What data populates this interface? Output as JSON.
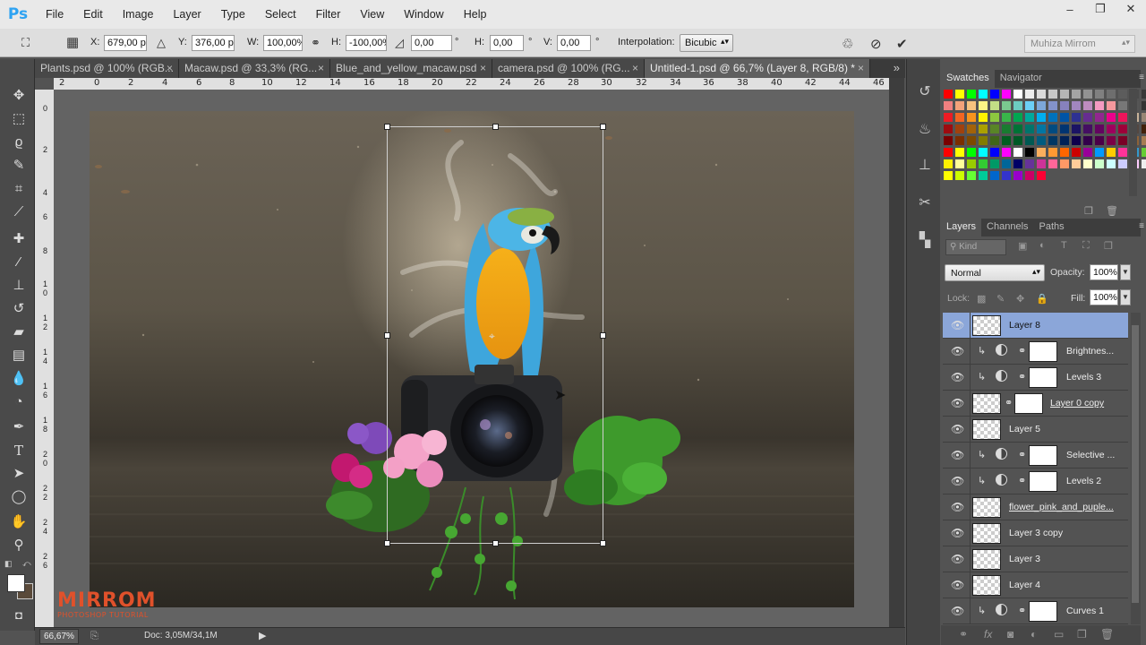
{
  "app": {
    "logo": "Ps"
  },
  "menu": [
    "File",
    "Edit",
    "Image",
    "Layer",
    "Type",
    "Select",
    "Filter",
    "View",
    "Window",
    "Help"
  ],
  "window_controls": {
    "minimize": "‒",
    "maximize": "❐",
    "close": "✕"
  },
  "options": {
    "x_label": "X:",
    "x_value": "679,00 px",
    "y_label": "Y:",
    "y_value": "376,00 px",
    "w_label": "W:",
    "w_value": "100,00%",
    "h_label": "H:",
    "h_value": "-100,00%",
    "angle_value": "0,00",
    "degree": "°",
    "hskew_label": "H:",
    "hskew_value": "0,00",
    "vskew_label": "V:",
    "vskew_value": "0,00",
    "interpolation_label": "Interpolation:",
    "interpolation_value": "Bicubic",
    "user": "Muhiza Mirrom"
  },
  "tabs": [
    {
      "label": "Plants.psd @ 100% (RGB...",
      "close": "×"
    },
    {
      "label": "Macaw.psd @ 33,3% (RG...",
      "close": "×"
    },
    {
      "label": "Blue_and_yellow_macaw.psd",
      "close": "×"
    },
    {
      "label": "camera.psd @ 100% (RG...",
      "close": "×"
    },
    {
      "label": "Untitled-1.psd @ 66,7% (Layer 8, RGB/8) *",
      "close": "×",
      "active": true
    }
  ],
  "tabs_overflow": "»",
  "ruler_top": [
    "2",
    "0",
    "2",
    "4",
    "6",
    "8",
    "10",
    "12",
    "14",
    "16",
    "18",
    "20",
    "22",
    "24",
    "26",
    "28",
    "30",
    "32",
    "34",
    "36",
    "38",
    "40",
    "42",
    "44",
    "46"
  ],
  "ruler_left": [
    "0",
    "2",
    "4",
    "6",
    "8",
    "1 0",
    "1 2",
    "1 4",
    "1 6",
    "1 8",
    "2 0",
    "2 2",
    "2 4",
    "2 6"
  ],
  "watermark": {
    "title": "MIRROM",
    "subtitle": "PHOTOSHOP TUTORIAL"
  },
  "status": {
    "zoom": "66,67%",
    "doc": "Doc: 3,05M/34,1M"
  },
  "swatches_panel": {
    "tabs": [
      "Swatches",
      "Navigator"
    ],
    "rows": [
      [
        "#ff0000",
        "#ffff00",
        "#00ff00",
        "#00ffff",
        "#0000ff",
        "#ff00ff",
        "#ffffff",
        "#ececec",
        "#dadada",
        "#c8c8c8",
        "#b6b6b6",
        "#a4a4a4",
        "#929292",
        "#808080",
        "#6e6e6e",
        "#5c5c5c",
        "#4a4a4a",
        "#383838",
        "#ff2a2a"
      ],
      [
        "#f08080",
        "#f4a27a",
        "#f7c27e",
        "#fdf585",
        "#c3df86",
        "#7ac98f",
        "#6ccbc1",
        "#6ccff6",
        "#7da7d9",
        "#8393ca",
        "#8781bd",
        "#a186be",
        "#bd8cbf",
        "#f49ac1",
        "#f5989d",
        "#777777",
        "#555555",
        "#333333",
        "#111111"
      ],
      [
        "#ed1c24",
        "#f26522",
        "#f7941d",
        "#fff200",
        "#8dc73f",
        "#39b54a",
        "#00a651",
        "#00a99d",
        "#00aeef",
        "#0072bc",
        "#0054a6",
        "#2e3192",
        "#662d91",
        "#92278f",
        "#ec008c",
        "#ed145b",
        "#c7b299",
        "#998675",
        "#736357"
      ],
      [
        "#9e0b0f",
        "#a0410d",
        "#a36209",
        "#aba000",
        "#598527",
        "#197b30",
        "#007236",
        "#00746b",
        "#0076a3",
        "#004b80",
        "#003471",
        "#1b1464",
        "#440e62",
        "#630460",
        "#9e005d",
        "#9e0039",
        "#534741",
        "#42210b",
        "#754c24"
      ],
      [
        "#790000",
        "#7b2e00",
        "#7d4900",
        "#827b00",
        "#406618",
        "#005e20",
        "#005826",
        "#005952",
        "#005b7f",
        "#003663",
        "#002157",
        "#0d004c",
        "#32004b",
        "#4b0049",
        "#7b0046",
        "#7a0026",
        "#8c6239",
        "#a67c52",
        "#c69c6d"
      ],
      [
        "#ff0000",
        "#ffff00",
        "#00ff00",
        "#00ffff",
        "#0000ff",
        "#ff00ff",
        "#ffffff",
        "#000000",
        "#fbaf5d",
        "#ff9933",
        "#ff6600",
        "#cc0000",
        "#990099",
        "#0099ff",
        "#ffcc00",
        "#ff3399",
        "#3399cc",
        "#66cc33",
        "#996633"
      ],
      [
        "#fff200",
        "#ffff99",
        "#99cc00",
        "#33cc33",
        "#009966",
        "#006699",
        "#000066",
        "#663399",
        "#cc3399",
        "#ff6699",
        "#ff9966",
        "#ffcc99",
        "#ffffcc",
        "#ccffcc",
        "#ccffff",
        "#ccccff",
        "#ffccff",
        "#eeeeee",
        "#cccccc"
      ],
      [
        "#ffff00",
        "#ccff00",
        "#66ff33",
        "#00cc99",
        "#0066cc",
        "#3333cc",
        "#9900cc",
        "#cc0066",
        "#ff0033"
      ]
    ]
  },
  "layers_panel": {
    "tabs": [
      "Layers",
      "Channels",
      "Paths"
    ],
    "kind_filter": "Kind",
    "blend_mode": "Normal",
    "opacity_label": "Opacity:",
    "opacity_value": "100%",
    "lock_label": "Lock:",
    "fill_label": "Fill:",
    "fill_value": "100%",
    "layers": [
      {
        "name": "Layer 8",
        "thumb": "checker",
        "selected": true
      },
      {
        "name": "Brightnes...",
        "thumb": "white",
        "clipped": true,
        "adjustment": true
      },
      {
        "name": "Levels 3",
        "thumb": "white",
        "clipped": true,
        "adjustment": true
      },
      {
        "name": "Layer 0 copy",
        "thumb": "checker",
        "mask": true
      },
      {
        "name": "Layer 5",
        "thumb": "checker"
      },
      {
        "name": "Selective ...",
        "thumb": "white",
        "clipped": true,
        "adjustment": true
      },
      {
        "name": "Levels 2",
        "thumb": "white",
        "clipped": true,
        "adjustment": true
      },
      {
        "name": "flower_pink_and_puple...",
        "thumb": "checker"
      },
      {
        "name": "Layer 3 copy",
        "thumb": "checker"
      },
      {
        "name": "Layer 3",
        "thumb": "checker"
      },
      {
        "name": "Layer 4",
        "thumb": "checker"
      },
      {
        "name": "Curves 1",
        "thumb": "white",
        "clipped": true,
        "adjustment": true
      }
    ]
  }
}
